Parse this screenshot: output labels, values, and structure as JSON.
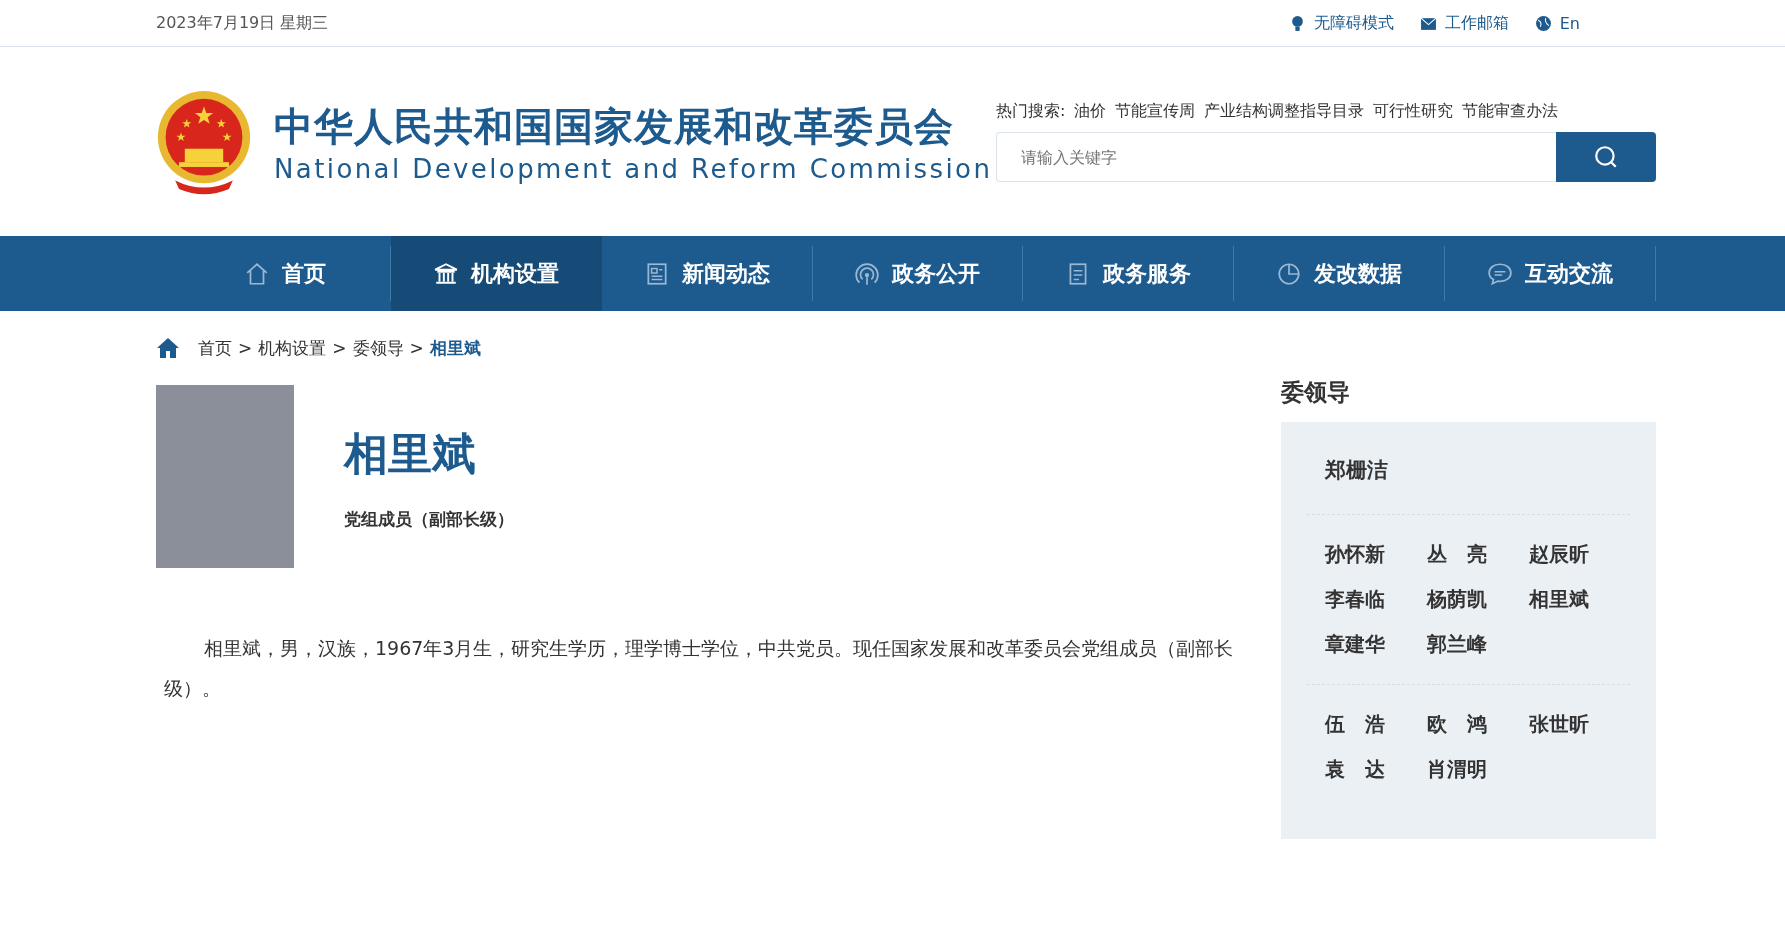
{
  "top_bar": {
    "date": "2023年7月19日 星期三",
    "links": [
      "无障碍模式",
      "工作邮箱",
      "En"
    ]
  },
  "header": {
    "title_cn": "中华人民共和国国家发展和改革委员会",
    "title_en": "National Development and Reform Commission",
    "hot_search": {
      "label": "热门搜索:",
      "terms": [
        "油价",
        "节能宣传周",
        "产业结构调整指导目录",
        "可行性研究",
        "节能审查办法"
      ]
    },
    "search": {
      "placeholder": "请输入关键字"
    }
  },
  "nav": [
    {
      "label": "首页",
      "selected": false
    },
    {
      "label": "机构设置",
      "selected": true
    },
    {
      "label": "新闻动态",
      "selected": false
    },
    {
      "label": "政务公开",
      "selected": false
    },
    {
      "label": "政务服务",
      "selected": false
    },
    {
      "label": "发改数据",
      "selected": false
    },
    {
      "label": "互动交流",
      "selected": false
    }
  ],
  "breadcrumb": [
    {
      "kind": "link",
      "label": "首页",
      "current": false
    },
    {
      "kind": "separator",
      "label": ">"
    },
    {
      "kind": "link",
      "label": "机构设置",
      "current": false
    },
    {
      "kind": "separator",
      "label": ">"
    },
    {
      "kind": "link",
      "label": "委领导",
      "current": false
    },
    {
      "kind": "separator",
      "label": ">"
    },
    {
      "kind": "link",
      "label": "相里斌",
      "current": true
    }
  ],
  "profile": {
    "name": "相里斌",
    "position": "党组成员（副部长级）",
    "bio": "相里斌，男，汉族，1967年3月生，研究生学历，理学博士学位，中共党员。现任国家发展和改革委员会党组成员（副部长级）。"
  },
  "sidebar": {
    "title": "委领导",
    "groups": [
      [
        "郑栅洁"
      ],
      [
        "孙怀新",
        "丛　亮",
        "赵辰昕",
        "李春临",
        "杨荫凯",
        "相里斌",
        "章建华",
        "郭兰峰"
      ],
      [
        "伍　浩",
        "欧　鸿",
        "张世昕",
        "袁　达",
        "肖渭明"
      ]
    ]
  }
}
